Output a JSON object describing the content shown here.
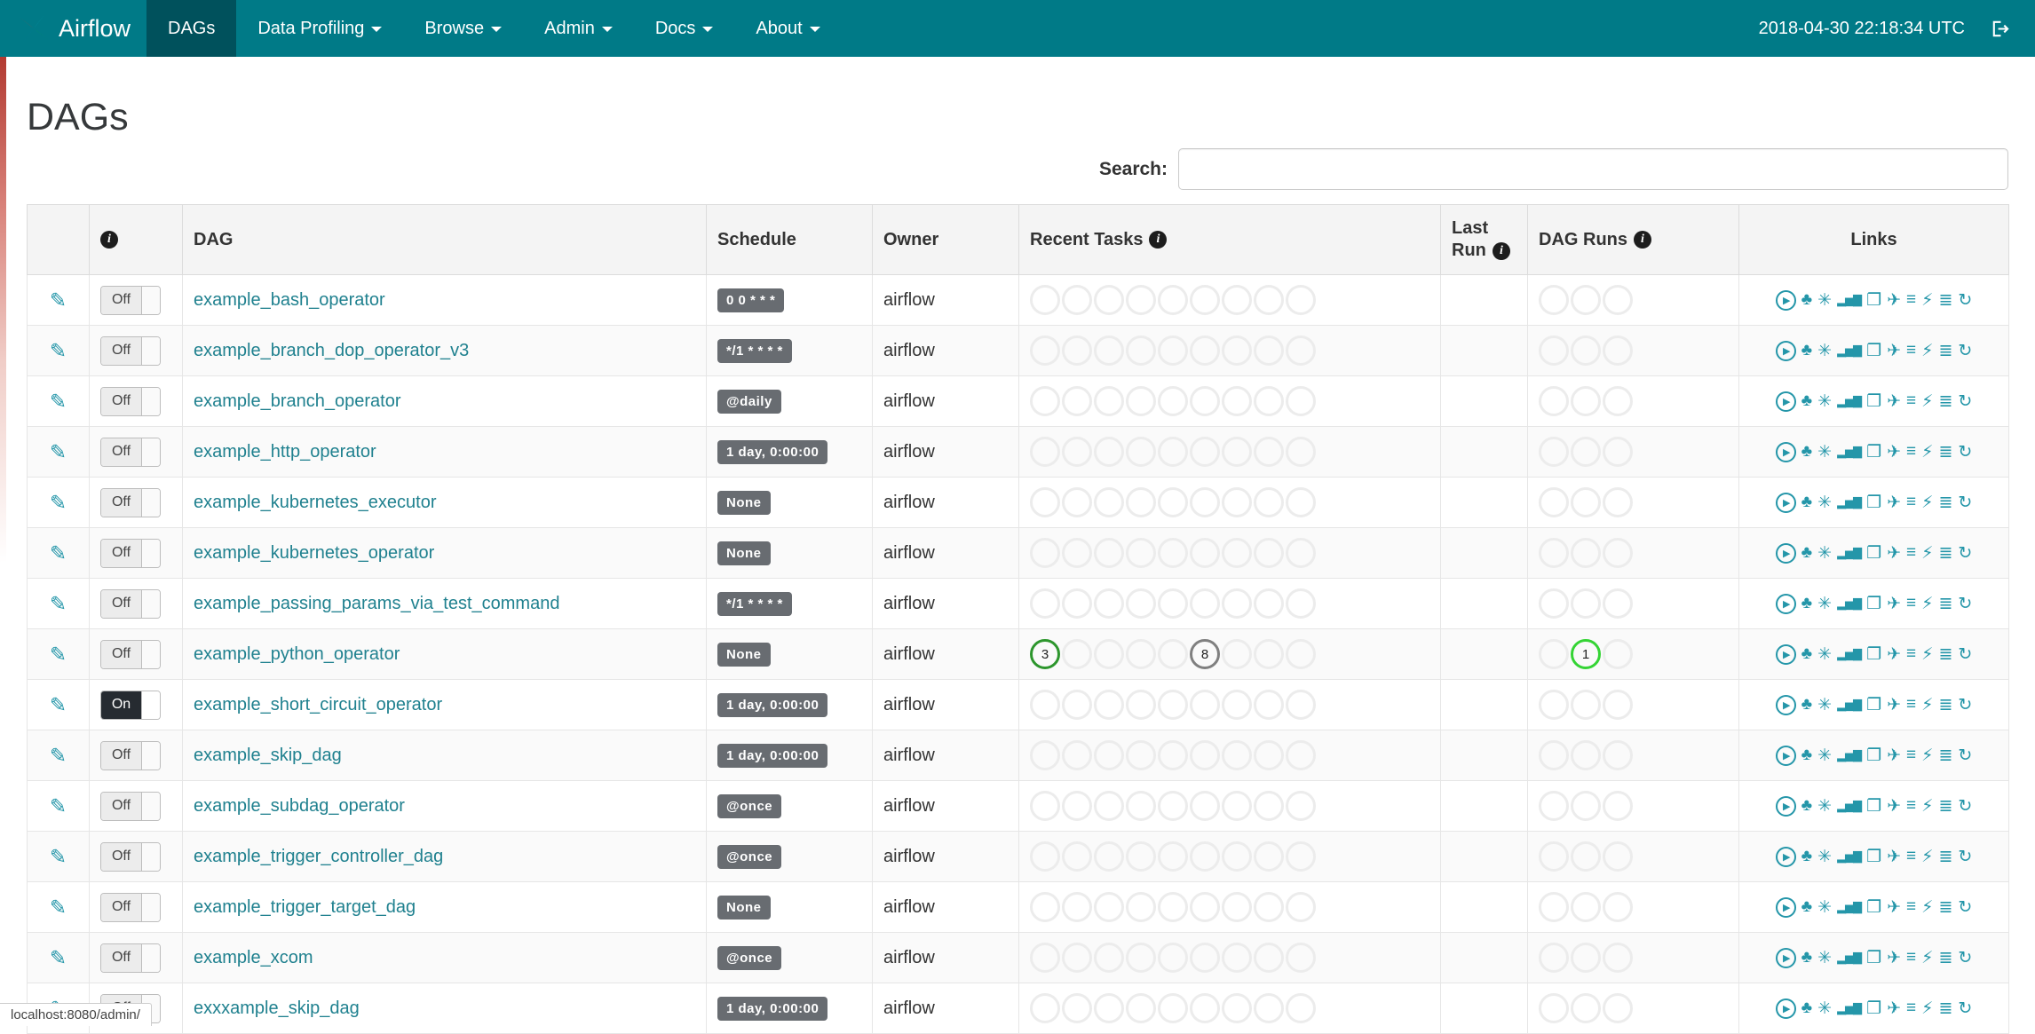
{
  "colors": {
    "navbar_bg": "#007a87",
    "navbar_active_bg": "#00515c",
    "accent_link": "#20818f",
    "accent_icon": "#2496a9",
    "success_green": "#2d962d",
    "running_green": "#35d435",
    "queued_gray": "#808080",
    "badge_bg": "#686c71",
    "toggle_on_bg": "#262b31"
  },
  "navbar": {
    "brand": "Airflow",
    "items": [
      {
        "label": "DAGs",
        "active": true,
        "dropdown": false
      },
      {
        "label": "Data Profiling",
        "active": false,
        "dropdown": true
      },
      {
        "label": "Browse",
        "active": false,
        "dropdown": true
      },
      {
        "label": "Admin",
        "active": false,
        "dropdown": true
      },
      {
        "label": "Docs",
        "active": false,
        "dropdown": true
      },
      {
        "label": "About",
        "active": false,
        "dropdown": true
      }
    ],
    "clock": "2018-04-30 22:18:34 UTC"
  },
  "page": {
    "title": "DAGs",
    "search_label": "Search:"
  },
  "table": {
    "headers": {
      "dag": "DAG",
      "schedule": "Schedule",
      "owner": "Owner",
      "recent_tasks": "Recent Tasks",
      "last_run": "Last Run",
      "dag_runs": "DAG Runs",
      "links": "Links"
    },
    "toggle_labels": {
      "on": "On",
      "off": "Off"
    },
    "recent_task_slots": 9,
    "dag_run_slots": 3,
    "rows": [
      {
        "name": "example_bash_operator",
        "schedule": "0 0 * * *",
        "owner": "airflow",
        "on": false,
        "last_run": "",
        "recent_tasks": [],
        "dag_runs": []
      },
      {
        "name": "example_branch_dop_operator_v3",
        "schedule": "*/1 * * * *",
        "owner": "airflow",
        "on": false,
        "last_run": "",
        "recent_tasks": [],
        "dag_runs": []
      },
      {
        "name": "example_branch_operator",
        "schedule": "@daily",
        "owner": "airflow",
        "on": false,
        "last_run": "",
        "recent_tasks": [],
        "dag_runs": []
      },
      {
        "name": "example_http_operator",
        "schedule": "1 day, 0:00:00",
        "owner": "airflow",
        "on": false,
        "last_run": "",
        "recent_tasks": [],
        "dag_runs": []
      },
      {
        "name": "example_kubernetes_executor",
        "schedule": "None",
        "owner": "airflow",
        "on": false,
        "last_run": "",
        "recent_tasks": [],
        "dag_runs": []
      },
      {
        "name": "example_kubernetes_operator",
        "schedule": "None",
        "owner": "airflow",
        "on": false,
        "last_run": "",
        "recent_tasks": [],
        "dag_runs": []
      },
      {
        "name": "example_passing_params_via_test_command",
        "schedule": "*/1 * * * *",
        "owner": "airflow",
        "on": false,
        "last_run": "",
        "recent_tasks": [],
        "dag_runs": []
      },
      {
        "name": "example_python_operator",
        "schedule": "None",
        "owner": "airflow",
        "on": false,
        "last_run": "",
        "recent_tasks": [
          {
            "slot": 0,
            "count": 3,
            "state": "success"
          },
          {
            "slot": 5,
            "count": 8,
            "state": "queued"
          }
        ],
        "dag_runs": [
          {
            "slot": 1,
            "count": 1,
            "state": "running"
          }
        ]
      },
      {
        "name": "example_short_circuit_operator",
        "schedule": "1 day, 0:00:00",
        "owner": "airflow",
        "on": true,
        "last_run": "",
        "recent_tasks": [],
        "dag_runs": []
      },
      {
        "name": "example_skip_dag",
        "schedule": "1 day, 0:00:00",
        "owner": "airflow",
        "on": false,
        "last_run": "",
        "recent_tasks": [],
        "dag_runs": []
      },
      {
        "name": "example_subdag_operator",
        "schedule": "@once",
        "owner": "airflow",
        "on": false,
        "last_run": "",
        "recent_tasks": [],
        "dag_runs": []
      },
      {
        "name": "example_trigger_controller_dag",
        "schedule": "@once",
        "owner": "airflow",
        "on": false,
        "last_run": "",
        "recent_tasks": [],
        "dag_runs": []
      },
      {
        "name": "example_trigger_target_dag",
        "schedule": "None",
        "owner": "airflow",
        "on": false,
        "last_run": "",
        "recent_tasks": [],
        "dag_runs": []
      },
      {
        "name": "example_xcom",
        "schedule": "@once",
        "owner": "airflow",
        "on": false,
        "last_run": "",
        "recent_tasks": [],
        "dag_runs": []
      },
      {
        "name": "exxxample_skip_dag",
        "schedule": "1 day, 0:00:00",
        "owner": "airflow",
        "on": false,
        "last_run": "",
        "recent_tasks": [],
        "dag_runs": []
      }
    ],
    "links": [
      {
        "name": "trigger-dag",
        "glyph": "▶",
        "circled": true
      },
      {
        "name": "tree-view",
        "glyph": "♣"
      },
      {
        "name": "graph-view",
        "glyph": "✳"
      },
      {
        "name": "task-duration",
        "glyph": "▂▅▇"
      },
      {
        "name": "task-tries",
        "glyph": "❐"
      },
      {
        "name": "landing-times",
        "glyph": "✈"
      },
      {
        "name": "gantt",
        "glyph": "≡"
      },
      {
        "name": "code-view",
        "glyph": "⚡"
      },
      {
        "name": "task-details",
        "glyph": "≣"
      },
      {
        "name": "refresh",
        "glyph": "↻"
      }
    ]
  },
  "status_bar": "localhost:8080/admin/"
}
